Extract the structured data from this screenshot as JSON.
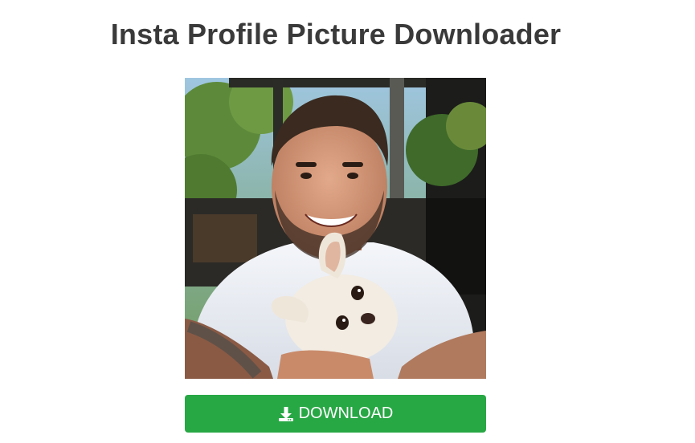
{
  "page": {
    "title": "Insta Profile Picture Downloader"
  },
  "profile_picture": {
    "alt": "Profile picture"
  },
  "download": {
    "label": "DOWNLOAD",
    "icon": "download-icon",
    "color": "#28a745"
  }
}
